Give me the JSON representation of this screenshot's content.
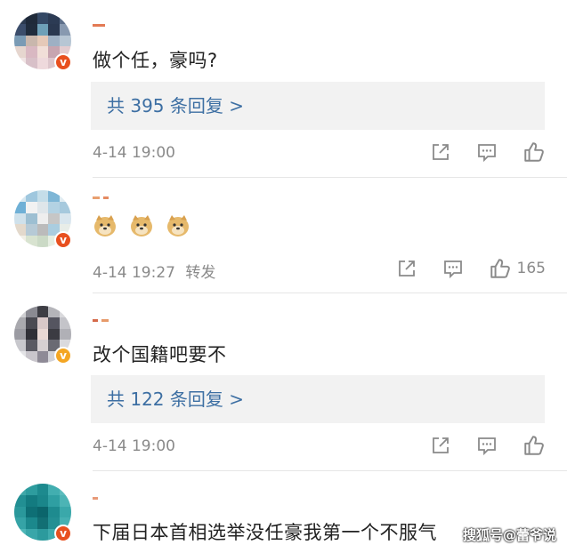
{
  "comments": [
    {
      "text": "做个任，豪吗?",
      "replies": "共 395 条回复 >",
      "time": "4-14 19:00",
      "likes": ""
    },
    {
      "text": "",
      "emojis": [
        "doge",
        "doge",
        "doge"
      ],
      "time": "4-14 19:27",
      "forward": "转发",
      "likes": "165"
    },
    {
      "text": "改个国籍吧要不",
      "replies": "共 122 条回复 >",
      "time": "4-14 19:00",
      "likes": ""
    },
    {
      "text": "下届日本首相选举没任豪我第一个不服气"
    }
  ],
  "watermark": "搜狐号@蕾爷说",
  "colors": {
    "reply_link": "#3d6fa3",
    "badge_red": "#e8501f",
    "badge_orange": "#f4a623",
    "meta_gray": "#8a8a8a"
  },
  "icons": [
    "share-icon",
    "comment-icon",
    "like-icon",
    "verified-badge-icon",
    "doge-emoji-icon"
  ]
}
